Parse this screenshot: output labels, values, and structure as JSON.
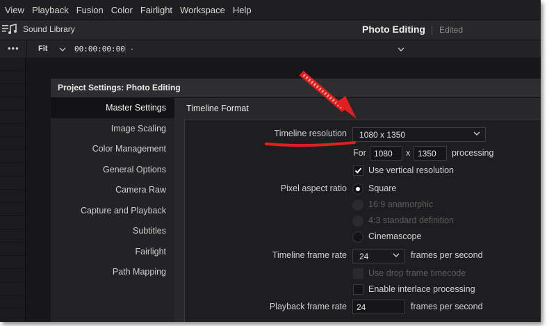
{
  "menu": [
    "View",
    "Playback",
    "Fusion",
    "Color",
    "Fairlight",
    "Workspace",
    "Help"
  ],
  "header": {
    "library": "Sound Library",
    "project_title": "Photo Editing",
    "status": "Edited"
  },
  "viewer": {
    "zoom": "Fit",
    "timecode": "00:00:00:00"
  },
  "dialog": {
    "title": "Project Settings:  Photo Editing",
    "sidebar": [
      "Master Settings",
      "Image Scaling",
      "Color Management",
      "General Options",
      "Camera Raw",
      "Capture and Playback",
      "Subtitles",
      "Fairlight",
      "Path Mapping"
    ],
    "section_title": "Timeline Format",
    "timeline_resolution": {
      "label": "Timeline resolution",
      "value": "1080 x 1350"
    },
    "processing": {
      "for_label": "For",
      "width": "1080",
      "x_label": "x",
      "height": "1350",
      "suffix": "processing"
    },
    "vertical": {
      "label": "Use vertical resolution",
      "checked": true
    },
    "pixel_aspect": {
      "label": "Pixel aspect ratio",
      "options": [
        "Square",
        "16:9 anamorphic",
        "4:3 standard definition",
        "Cinemascope"
      ],
      "selected": "Square"
    },
    "frame_rate": {
      "label": "Timeline frame rate",
      "value": "24",
      "suffix": "frames per second"
    },
    "drop_frame": {
      "label": "Use drop frame timecode",
      "enabled": false
    },
    "interlace": {
      "label": "Enable interlace processing",
      "checked": false
    },
    "playback_rate": {
      "label": "Playback frame rate",
      "value": "24",
      "suffix": "frames per second"
    }
  },
  "annotation": {
    "arrow_color": "#e02020",
    "underline_color": "#e02020"
  }
}
